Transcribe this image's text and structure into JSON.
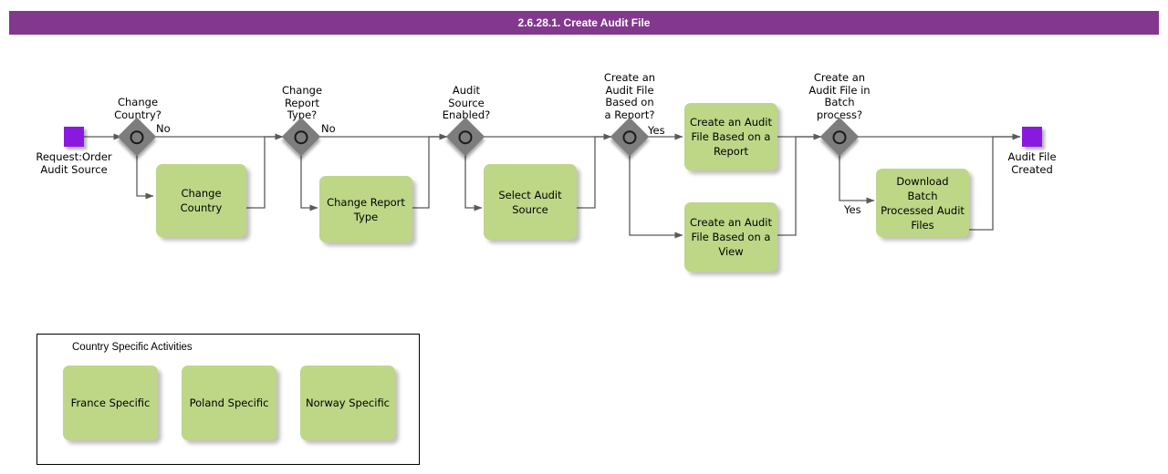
{
  "title": "2.6.28.1. Create Audit File",
  "diagram": {
    "start_event": {
      "name": "start-event",
      "label": "Request:Order\nAudit Source"
    },
    "end_event": {
      "name": "end-event",
      "label": "Audit File\nCreated"
    },
    "gateways": [
      {
        "id": "gw-change-country",
        "label": "Change\nCountry?",
        "flow_label": "No"
      },
      {
        "id": "gw-change-report",
        "label": "Change\nReport\nType?",
        "flow_label": "No"
      },
      {
        "id": "gw-audit-enabled",
        "label": "Audit\nSource\nEnabled?",
        "flow_label": ""
      },
      {
        "id": "gw-based-on-report",
        "label": "Create an\nAudit File\nBased on\na Report?",
        "flow_label": "Yes"
      },
      {
        "id": "gw-batch-process",
        "label": "Create an\nAudit File in\nBatch\nprocess?",
        "flow_label": "Yes"
      }
    ],
    "tasks": [
      {
        "id": "task-change-country",
        "label": "Change\nCountry"
      },
      {
        "id": "task-change-report-type",
        "label": "Change Report\nType"
      },
      {
        "id": "task-select-audit-source",
        "label": "Select Audit\nSource"
      },
      {
        "id": "task-file-from-report",
        "label": "Create an Audit\nFile Based on a\nReport"
      },
      {
        "id": "task-file-from-view",
        "label": "Create an Audit\nFile Based on a\nView"
      },
      {
        "id": "task-download-batch",
        "label": "Download Batch\nProcessed Audit\nFiles"
      }
    ]
  },
  "legend": {
    "title": "Country Specific Activities",
    "items": [
      {
        "id": "legend-france",
        "label": "France Specific"
      },
      {
        "id": "legend-poland",
        "label": "Poland Specific"
      },
      {
        "id": "legend-norway",
        "label": "Norway Specific"
      }
    ]
  },
  "colors": {
    "header": "#82388C",
    "task": "#BDD787",
    "event": "#8A19E0",
    "gateway": "#7D7D7D",
    "edge": "#5A5A5A"
  }
}
